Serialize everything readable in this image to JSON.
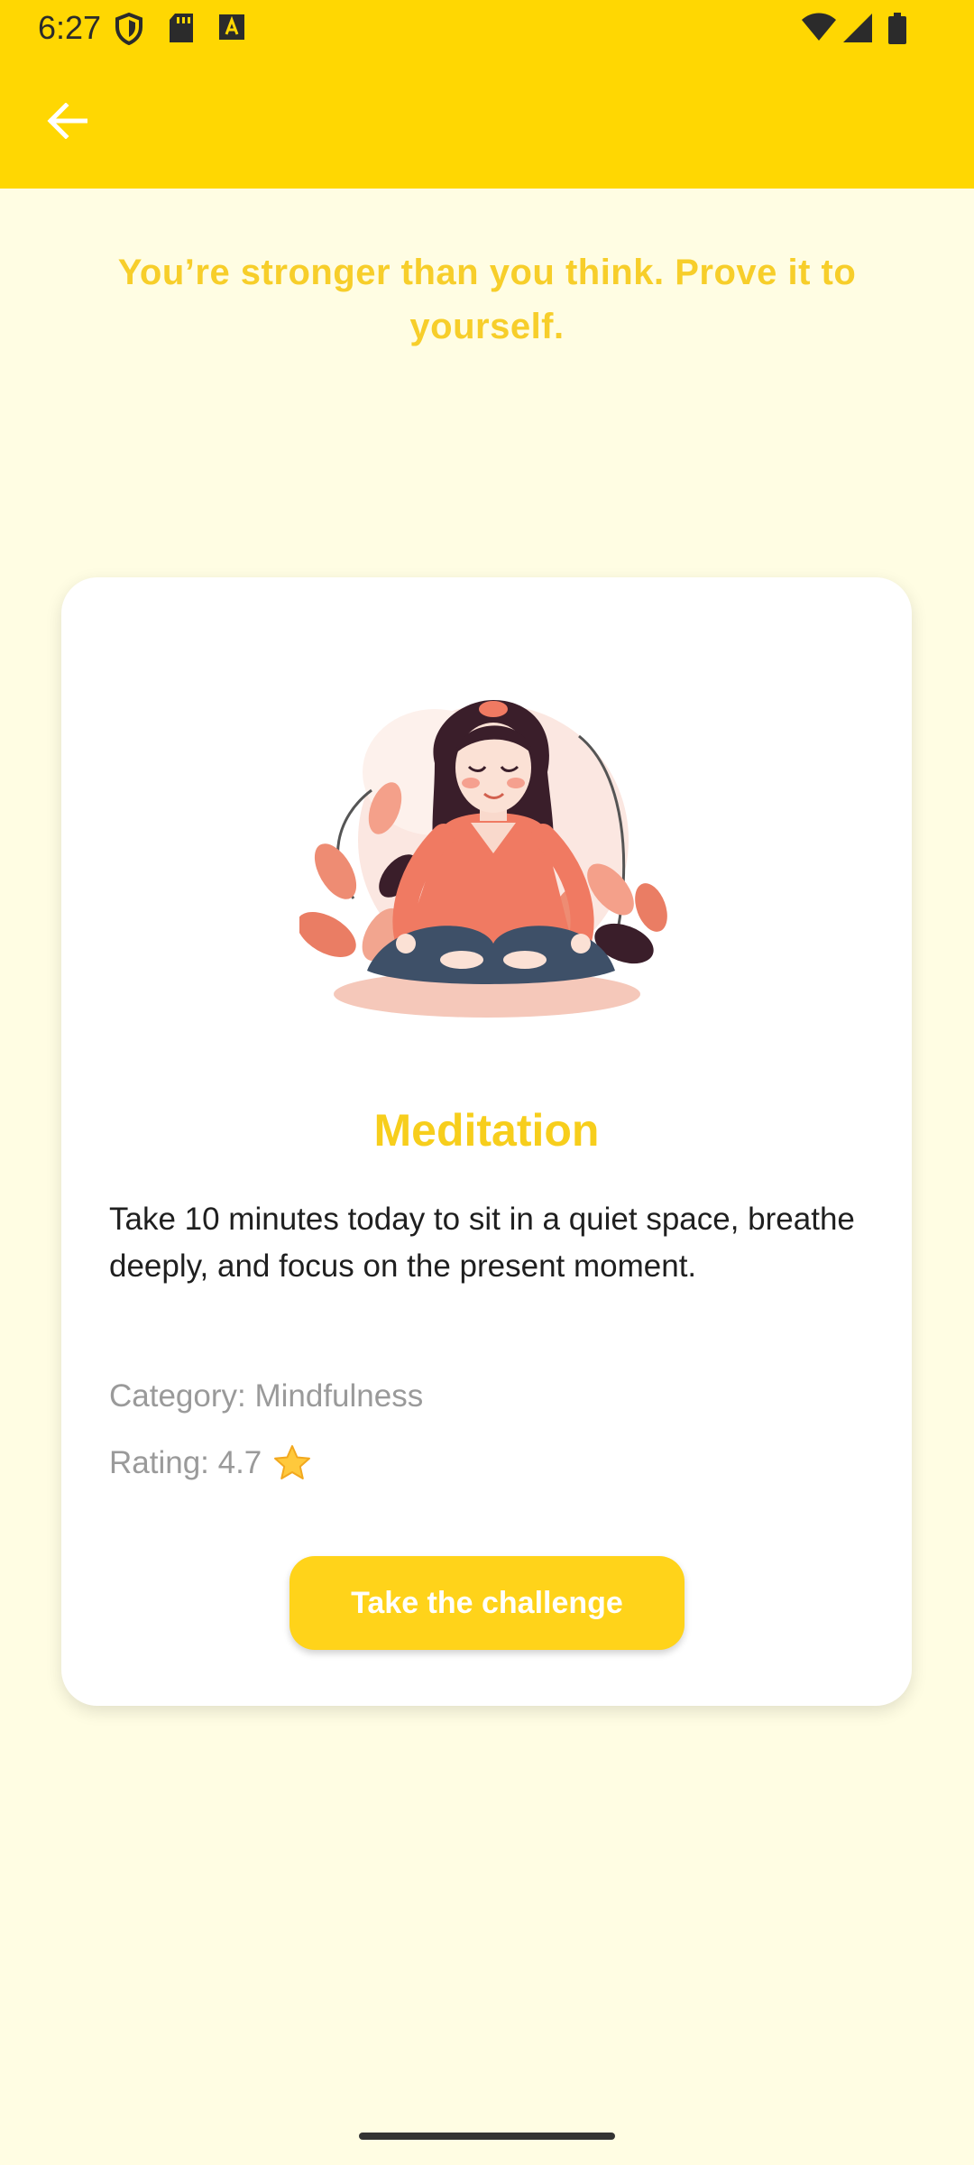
{
  "status_bar": {
    "time": "6:27",
    "left_icons": [
      "shield-icon",
      "sd-card-icon",
      "a-font-icon"
    ],
    "right_icons": [
      "wifi-icon",
      "signal-icon",
      "battery-icon"
    ]
  },
  "app_bar": {
    "back_icon": "arrow-left-icon",
    "color": "#FFD702"
  },
  "motivation": {
    "text": "You’re stronger than you think. Prove it to yourself."
  },
  "challenge": {
    "illustration": "woman-meditating-illustration",
    "title": "Meditation",
    "description": "Take 10 minutes today to sit in a quiet space, breathe deeply, and focus on the present moment.",
    "category": "Category: Mindfulness",
    "rating": "Rating: 4.7",
    "rating_icon": "star-icon",
    "button_label": "Take the challenge"
  },
  "colors": {
    "accent": "#FFD702",
    "background": "#FFFDE3",
    "title": "#F7CE1C",
    "button": "#FFD31A"
  }
}
